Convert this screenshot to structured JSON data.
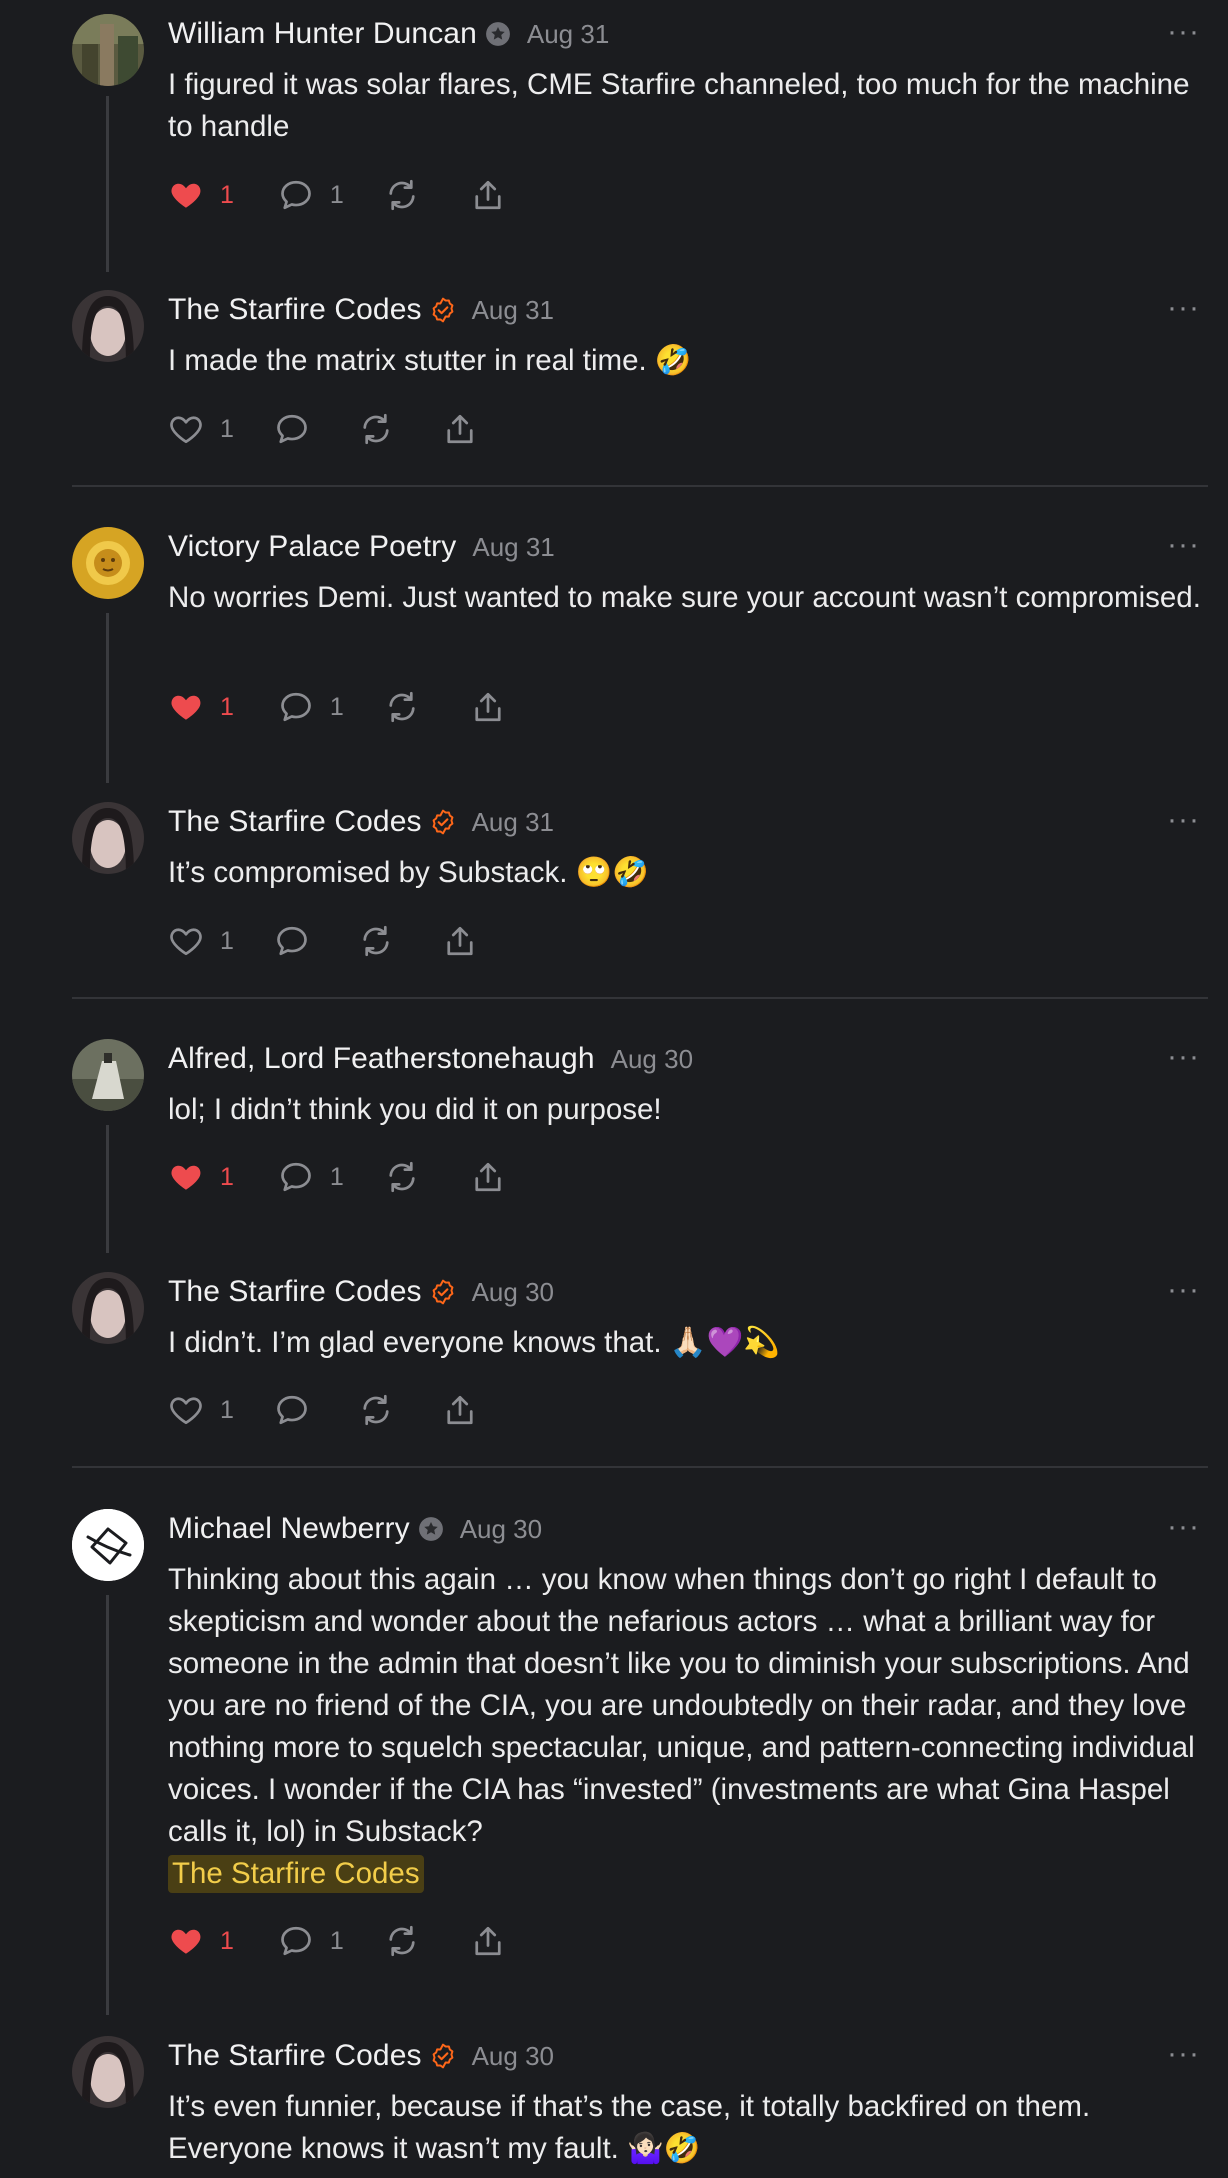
{
  "colors": {
    "background": "#1b1c1f",
    "like_active": "#ee4b4e",
    "verified_orange": "#ff6719",
    "mention_bg": "#4a3f14",
    "mention_text": "#f2cd4a"
  },
  "comments": [
    {
      "author": "William Hunter Duncan",
      "badge": "subscriber-badge-icon",
      "date": "Aug 31",
      "text": "I figured it was solar flares, CME Starfire channeled, too much for the machine to handle",
      "likes": "1",
      "liked": true,
      "replies": "1",
      "more": "···"
    },
    {
      "author": "The Starfire Codes",
      "badge": "verified-check-icon",
      "date": "Aug 31",
      "text": "I made the matrix stutter in real time. 🤣",
      "likes": "1",
      "liked": false,
      "replies": "",
      "more": "···"
    },
    {
      "author": "Victory Palace Poetry",
      "badge": "",
      "date": "Aug 31",
      "text": "No worries Demi. Just wanted to make sure your account wasn’t compromised.",
      "likes": "1",
      "liked": true,
      "replies": "1",
      "more": "···"
    },
    {
      "author": "The Starfire Codes",
      "badge": "verified-check-icon",
      "date": "Aug 31",
      "text": "It’s compromised by Substack. 🙄🤣",
      "likes": "1",
      "liked": false,
      "replies": "",
      "more": "···"
    },
    {
      "author": "Alfred, Lord Featherstonehaugh",
      "badge": "",
      "date": "Aug 30",
      "text": "lol; I didn’t think you did it on purpose!",
      "likes": "1",
      "liked": true,
      "replies": "1",
      "more": "···"
    },
    {
      "author": "The Starfire Codes",
      "badge": "verified-check-icon",
      "date": "Aug 30",
      "text": "I didn’t. I’m glad everyone knows that. 🙏🏻💜💫",
      "likes": "1",
      "liked": false,
      "replies": "",
      "more": "···"
    },
    {
      "author": "Michael Newberry",
      "badge": "subscriber-badge-icon",
      "date": "Aug 30",
      "text": "Thinking about this again … you know when things don’t go right I default to skepticism and wonder about the nefarious actors … what a brilliant way for someone in the admin that doesn’t like you to diminish your subscriptions. And you are no friend of the CIA, you are undoubtedly on their radar, and they love nothing more to squelch spectacular, unique, and pattern-connecting individual voices. I wonder if the CIA has “invested” (investments are what Gina Haspel calls it, lol) in Substack?",
      "mention": "The Starfire Codes",
      "likes": "1",
      "liked": true,
      "replies": "1",
      "more": "···"
    },
    {
      "author": "The Starfire Codes",
      "badge": "verified-check-icon",
      "date": "Aug 30",
      "text": "It’s even funnier, because if that’s the case, it totally backfired on them. Everyone knows it wasn’t my fault. 🤷🏻‍♀️🤣",
      "more": "···"
    }
  ]
}
